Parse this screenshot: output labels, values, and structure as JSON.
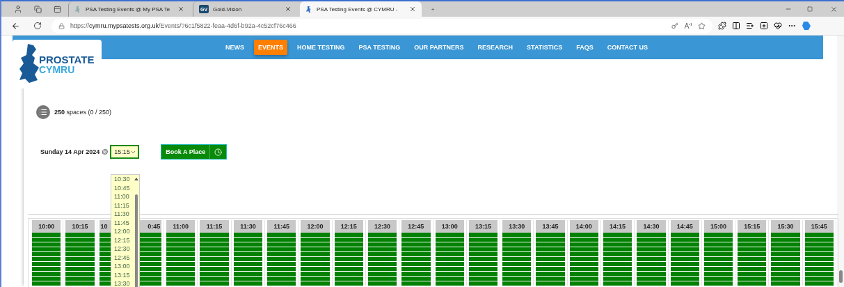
{
  "browser": {
    "tabs": [
      {
        "title": "PSA Testing Events @ My PSA Te",
        "selected": false
      },
      {
        "title": "Gold-Vision",
        "selected": false
      },
      {
        "title": "PSA Testing Events @ CYMRU -",
        "selected": true
      }
    ],
    "gv_badge": "GV",
    "new_tab": "+",
    "url": {
      "scheme": "https://",
      "host": "cymru.mypsatests.org.uk",
      "path": "/Events/?6c1f5822-feaa-4d6f-b92a-4c52cf76c466"
    }
  },
  "site": {
    "logo": {
      "line_1": "PROSTATE",
      "line_2": "CYMRU"
    },
    "nav": [
      {
        "label": "NEWS",
        "selected": false
      },
      {
        "label": "EVENTS",
        "selected": true
      },
      {
        "label": "HOME TESTING",
        "selected": false
      },
      {
        "label": "PSA TESTING",
        "selected": false
      },
      {
        "label": "OUR PARTNERS",
        "selected": false
      },
      {
        "label": "RESEARCH",
        "selected": false
      },
      {
        "label": "STATISTICS",
        "selected": false
      },
      {
        "label": "FAQS",
        "selected": false
      },
      {
        "label": "CONTACT US",
        "selected": false
      }
    ]
  },
  "capacity": "**250** spaces (0 / 250)",
  "booking": {
    "date": "Sunday 14 Apr 2024",
    "at": "@",
    "time": "15:15",
    "button": "Book A Place",
    "options": [
      {
        "label": "10:30",
        "selected": false
      },
      {
        "label": "10:45",
        "selected": false
      },
      {
        "label": "11:00",
        "selected": false
      },
      {
        "label": "11:15",
        "selected": false
      },
      {
        "label": "11:30",
        "selected": false
      },
      {
        "label": "11:45",
        "selected": false
      },
      {
        "label": "12:00",
        "selected": false
      },
      {
        "label": "12:15",
        "selected": false
      },
      {
        "label": "12:30",
        "selected": false
      },
      {
        "label": "12:45",
        "selected": false
      },
      {
        "label": "13:00",
        "selected": false
      },
      {
        "label": "13:15",
        "selected": false
      },
      {
        "label": "13:30",
        "selected": false
      }
    ]
  },
  "slots": [
    {
      "time": "10:00",
      "kind": "full"
    },
    {
      "time": "10:15",
      "kind": "full"
    },
    {
      "time": "10",
      "kind": "cut_right"
    },
    {
      "time": "0:45",
      "kind": "cut_left"
    },
    {
      "time": "11:00",
      "kind": "full"
    },
    {
      "time": "11:15",
      "kind": "full"
    },
    {
      "time": "11:30",
      "kind": "full"
    },
    {
      "time": "11:45",
      "kind": "full"
    },
    {
      "time": "12:00",
      "kind": "full"
    },
    {
      "time": "12:15",
      "kind": "full"
    },
    {
      "time": "12:30",
      "kind": "full"
    },
    {
      "time": "12:45",
      "kind": "full"
    },
    {
      "time": "13:00",
      "kind": "full"
    },
    {
      "time": "13:15",
      "kind": "full"
    },
    {
      "time": "13:30",
      "kind": "full"
    },
    {
      "time": "13:45",
      "kind": "full"
    },
    {
      "time": "14:00",
      "kind": "full"
    },
    {
      "time": "14:15",
      "kind": "full"
    },
    {
      "time": "14:30",
      "kind": "full"
    },
    {
      "time": "14:45",
      "kind": "full"
    },
    {
      "time": "15:00",
      "kind": "full"
    },
    {
      "time": "15:15",
      "kind": "full"
    },
    {
      "time": "15:30",
      "kind": "full"
    },
    {
      "time": "15:45",
      "kind": "full"
    }
  ]
}
